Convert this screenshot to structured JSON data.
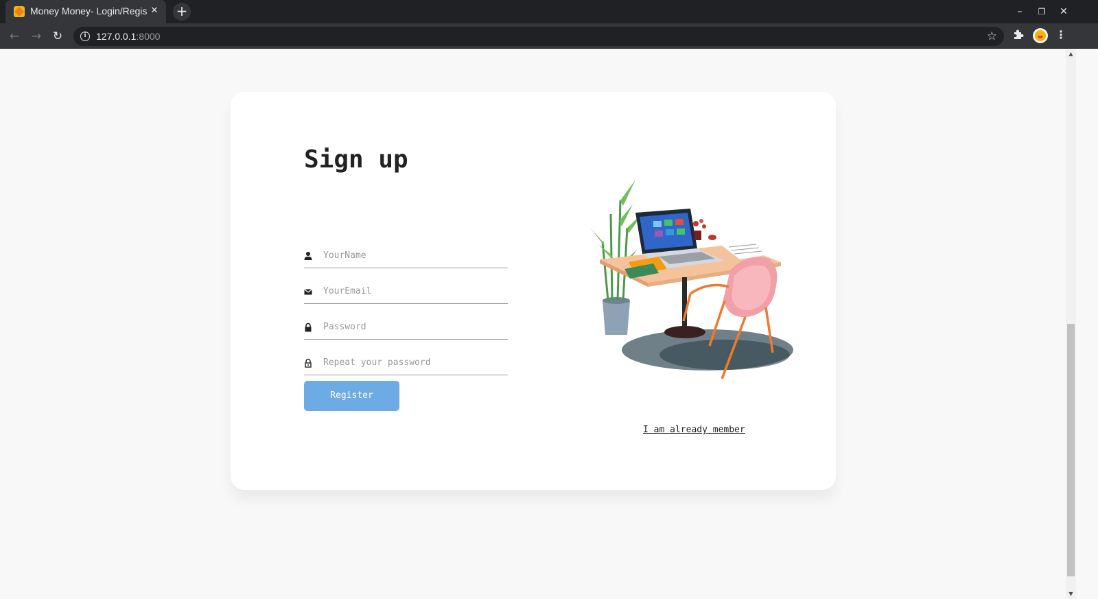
{
  "browser": {
    "tab_title": "Money Money- Login/Register",
    "tab_close": "✕",
    "new_tab": "+",
    "url_host": "127.0.0.1",
    "url_port": ":8000",
    "window_controls": {
      "minimize": "–",
      "restore": "❐",
      "close": "✕"
    }
  },
  "signup": {
    "title": "Sign up",
    "fields": {
      "name_placeholder": "YourName",
      "email_placeholder": "YourEmail",
      "password_placeholder": "Password",
      "repeat_placeholder": "Repeat your password"
    },
    "register_label": "Register",
    "member_link": "I am already member"
  },
  "icons": {
    "name": "person-icon",
    "email": "envelope-icon",
    "password": "lock-icon",
    "repeat": "lock-outline-icon"
  },
  "colors": {
    "button": "#6dabe4",
    "page_background": "#f8f8f8",
    "card_background": "#ffffff"
  }
}
